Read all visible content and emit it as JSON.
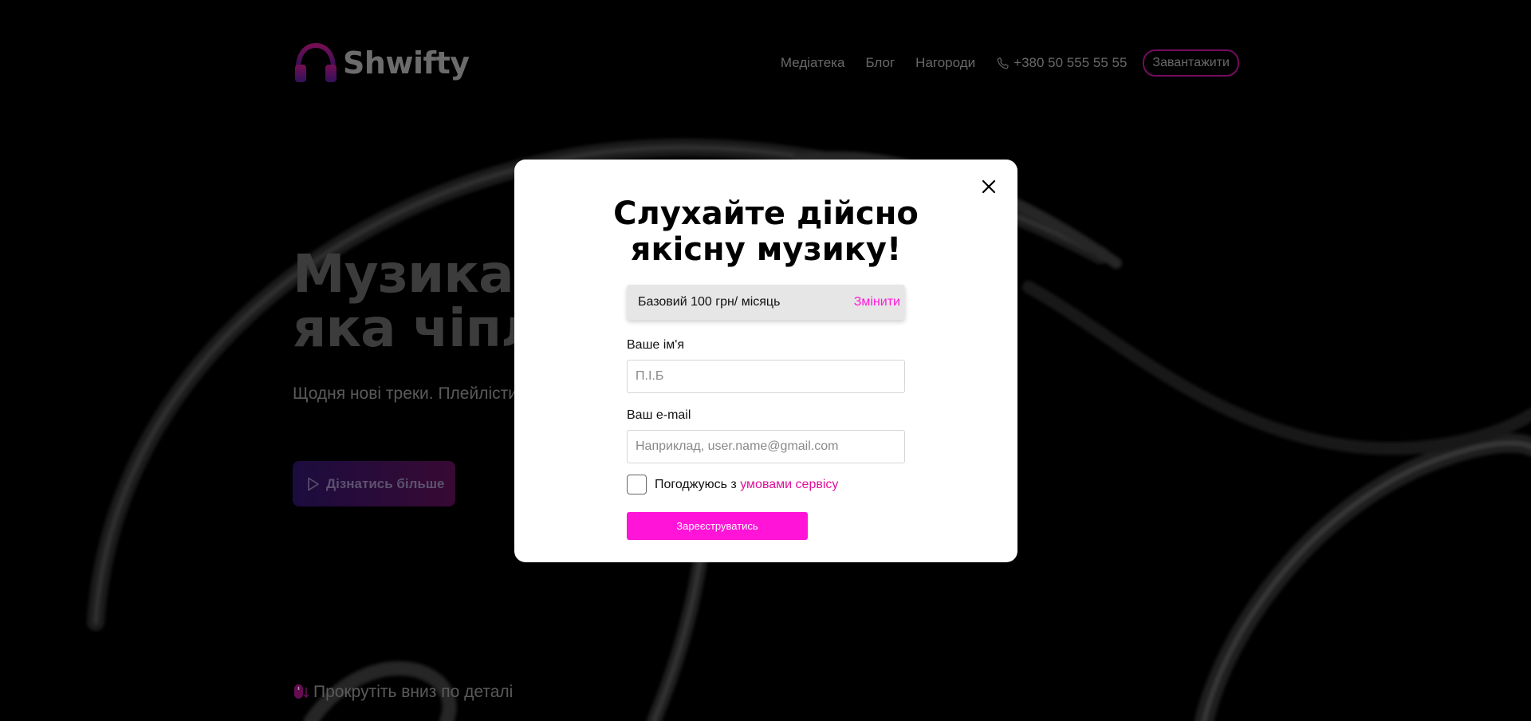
{
  "header": {
    "logo_text": "Shwifty",
    "logo_icon": "headphones-icon",
    "nav": [
      {
        "label": "Медіатека"
      },
      {
        "label": "Блог"
      },
      {
        "label": "Нагороди"
      }
    ],
    "phone": "+380 50 555 55 55",
    "phone_icon": "phone-icon",
    "cta_label": "Завантажити"
  },
  "hero": {
    "title_line1": "Музика,",
    "title_line2": "яка чіпля",
    "subtitle": "Щодня нові треки. Плейлісти",
    "button_label": "Дізнатись більше",
    "button_icon": "play-icon",
    "scroll_hint": "Прокрутіть вниз по деталі",
    "scroll_icon": "mouse-icon"
  },
  "modal": {
    "title_line1": "Слухайте дійсно",
    "title_line2": "якісну музику!",
    "plan_text": "Базовий 100 грн/ місяць",
    "plan_change": "Змінити",
    "name_label": "Ваше ім'я",
    "name_placeholder": "П.І.Б",
    "email_label": "Ваш e-mail",
    "email_placeholder": "Наприклад, user.name@gmail.com",
    "agree_prefix": "Погоджуюсь з ",
    "agree_link": "умовами сервісу",
    "agree_checked": false,
    "submit_label": "Зареєструватись",
    "close_icon": "close-icon"
  },
  "colors": {
    "accent": "#ff14d8",
    "link": "#e0109c",
    "background": "#000000",
    "modal_bg": "#ffffff"
  }
}
